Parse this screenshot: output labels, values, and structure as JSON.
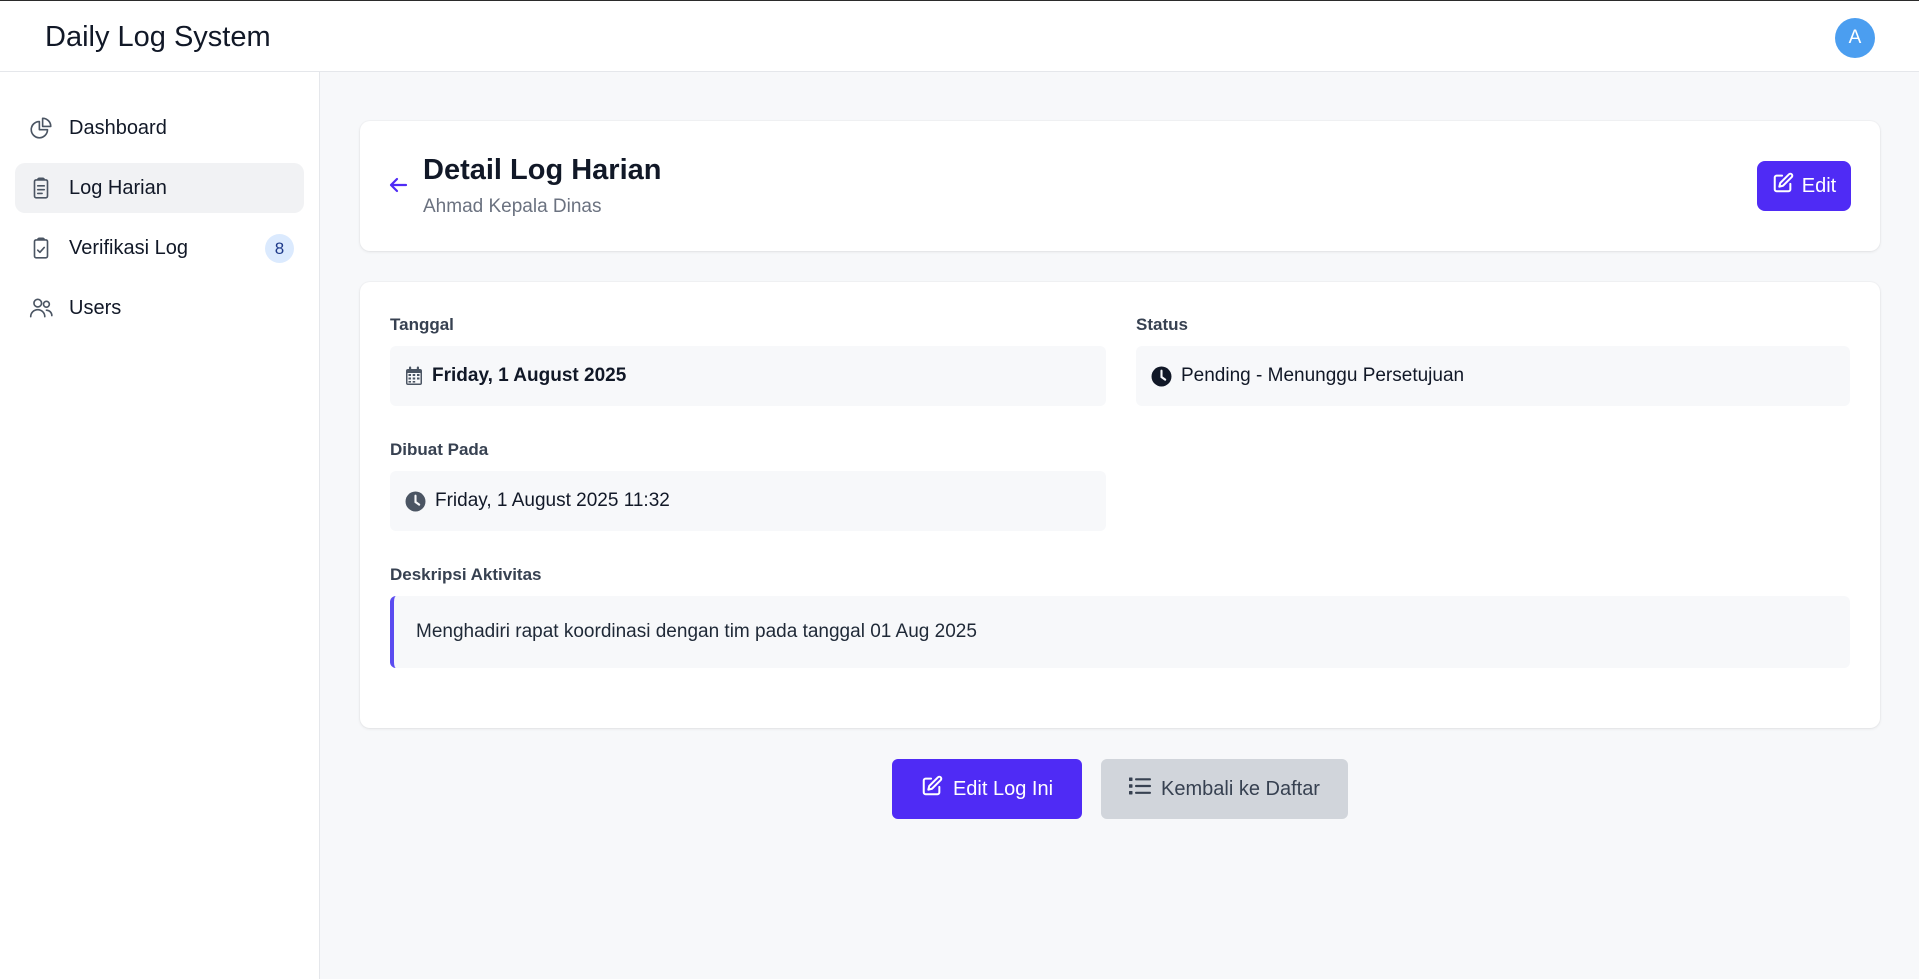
{
  "app": {
    "title": "Daily Log System",
    "avatar_initial": "A"
  },
  "sidebar": {
    "items": [
      {
        "label": "Dashboard",
        "icon": "chart-pie-icon",
        "active": false
      },
      {
        "label": "Log Harian",
        "icon": "clipboard-document-list-icon",
        "active": true
      },
      {
        "label": "Verifikasi Log",
        "icon": "clipboard-check-icon",
        "active": false,
        "badge": "8"
      },
      {
        "label": "Users",
        "icon": "users-icon",
        "active": false
      }
    ]
  },
  "header": {
    "title": "Detail Log Harian",
    "subtitle": "Ahmad Kepala Dinas",
    "edit_label": "Edit"
  },
  "detail": {
    "tanggal_label": "Tanggal",
    "tanggal_value": "Friday, 1 August 2025",
    "status_label": "Status",
    "status_value": "Pending - Menunggu Persetujuan",
    "dibuat_label": "Dibuat Pada",
    "dibuat_value": "Friday, 1 August 2025 11:32",
    "deskripsi_label": "Deskripsi Aktivitas",
    "deskripsi_value": "Menghadiri rapat koordinasi dengan tim pada tanggal 01 Aug 2025"
  },
  "actions": {
    "edit_label": "Edit Log Ini",
    "back_label": "Kembali ke Daftar"
  },
  "colors": {
    "accent": "#4f2bf5",
    "avatar": "#4b9ef0",
    "badge_bg": "#dbeafe",
    "secondary_btn": "#d1d5db"
  }
}
